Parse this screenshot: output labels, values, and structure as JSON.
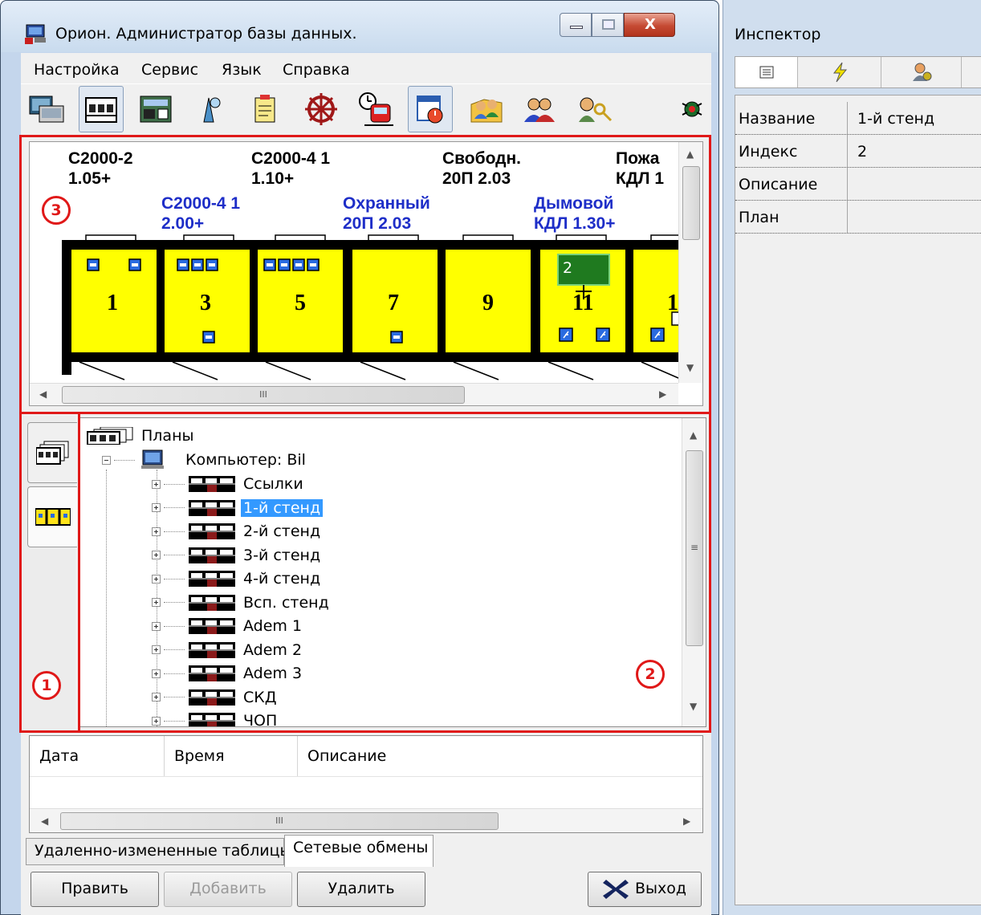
{
  "window": {
    "title": "Орион. Администратор базы данных.",
    "close_glyph": "X"
  },
  "menu": {
    "items": [
      "Настройка",
      "Сервис",
      "Язык",
      "Справка"
    ]
  },
  "toolbar": {
    "icons": [
      "computer-icon",
      "plan-icon",
      "device-panel-icon",
      "zone-icon",
      "document-icon",
      "wheel-icon",
      "train-schedule-icon",
      "calendar-alarm-icon",
      "users-icon",
      "group-icon",
      "keys-icon",
      "bug-icon"
    ]
  },
  "annotations": [
    "1",
    "2",
    "3"
  ],
  "plan": {
    "black_labels": [
      {
        "line1": "С2000-2",
        "line2": "1.05+"
      },
      {
        "line1": "С2000-4 1",
        "line2": "1.10+"
      },
      {
        "line1": "Свободн.",
        "line2": "20П 2.03"
      },
      {
        "line1": "Пожа",
        "line2": "КДЛ 1"
      }
    ],
    "blue_labels": [
      {
        "line1": "С2000-4 1",
        "line2": "2.00+"
      },
      {
        "line1": "Охранный",
        "line2": "20П 2.03"
      },
      {
        "line1": "Дымовой",
        "line2": "КДЛ 1.30+"
      }
    ],
    "rooms": [
      "1",
      "3",
      "5",
      "7",
      "9",
      "11",
      "1"
    ],
    "selected_zone_number": "2",
    "colors": {
      "room": "#ffff00",
      "wall": "#000000",
      "zone": "#1f7a1f",
      "sensor": "#1e5bd8"
    },
    "scroll_mark": "III"
  },
  "tree": {
    "root": "Планы",
    "computer": "Компьютер: Bil",
    "items": [
      "Ссылки",
      "1-й стенд",
      "2-й стенд",
      "3-й стенд",
      "4-й стенд",
      "Всп. стенд",
      "Adem 1",
      "Adem 2",
      "Adem 3",
      "СКД",
      "ЧОП"
    ],
    "selected": "1-й стенд"
  },
  "log": {
    "columns": [
      "Дата",
      "Время",
      "Описание"
    ],
    "scroll_mark": "III"
  },
  "bottom_tabs": [
    {
      "label": "Удаленно-измененные таблицы",
      "active": false
    },
    {
      "label": "Сетевые обмены",
      "active": true
    }
  ],
  "buttons": {
    "edit": "Править",
    "add": "Добавить",
    "delete": "Удалить",
    "exit": "Выход"
  },
  "inspector": {
    "title": "Инспектор",
    "tabs": [
      "properties-icon",
      "events-icon",
      "users-settings-icon"
    ],
    "properties": [
      {
        "name": "Название",
        "value": "1-й стенд"
      },
      {
        "name": "Индекс",
        "value": "2"
      },
      {
        "name": "Описание",
        "value": ""
      },
      {
        "name": "План",
        "value": ""
      }
    ]
  }
}
